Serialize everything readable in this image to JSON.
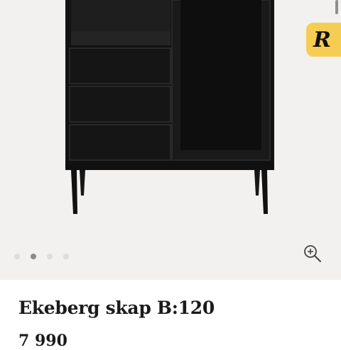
{
  "product": {
    "title": "Ekeberg skap B:120",
    "price": "7 990",
    "image_alt": "Black wooden cabinet with glass door and three drawers"
  },
  "gallery": {
    "image_count": 4,
    "active_index": 1,
    "zoom_icon": "zoom-in-icon",
    "background": "#f2f1ef"
  },
  "badge": {
    "letter": "R",
    "color": "#f6cd53"
  },
  "colors": {
    "furniture": "#111111",
    "text": "#1b1b1b"
  }
}
